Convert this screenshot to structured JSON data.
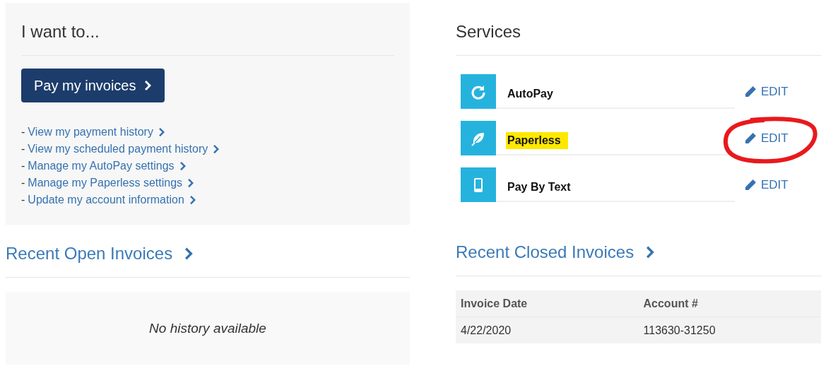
{
  "actions": {
    "title": "I want to...",
    "primary_button": {
      "label": "Pay my invoices"
    },
    "links": [
      {
        "bullet": "-",
        "label": "View my payment history"
      },
      {
        "bullet": "-",
        "label": "View my scheduled payment history"
      },
      {
        "bullet": "-",
        "label": "Manage my AutoPay settings"
      },
      {
        "bullet": "-",
        "label": "Manage my Paperless settings"
      },
      {
        "bullet": "-",
        "label": "Update my account information"
      }
    ]
  },
  "services": {
    "title": "Services",
    "items": [
      {
        "name": "AutoPay",
        "highlighted": false,
        "edit": {
          "label": "EDIT",
          "circled": false
        }
      },
      {
        "name": "Paperless",
        "highlighted": true,
        "edit": {
          "label": "EDIT",
          "circled": true
        }
      },
      {
        "name": "Pay By Text",
        "highlighted": false,
        "edit": {
          "label": "EDIT",
          "circled": false
        }
      }
    ]
  },
  "open_invoices": {
    "title": "Recent Open Invoices",
    "empty_message": "No history available"
  },
  "closed_invoices": {
    "title": "Recent Closed Invoices",
    "table": {
      "columns": [
        "Invoice Date",
        "Account #"
      ],
      "rows": [
        [
          "4/22/2020",
          "113630-31250"
        ]
      ]
    }
  }
}
